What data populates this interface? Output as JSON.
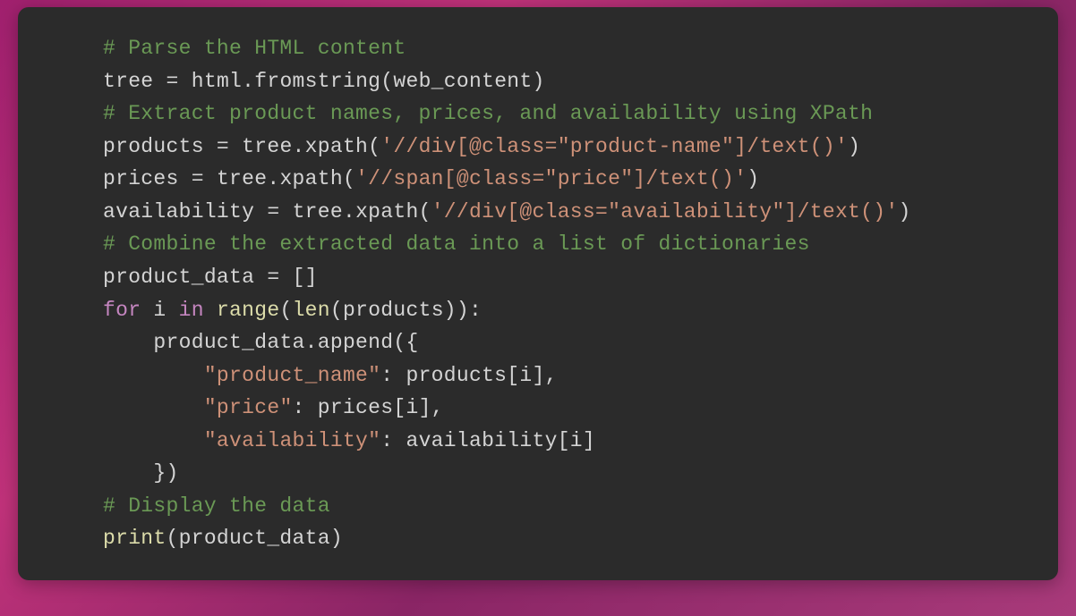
{
  "code": {
    "lines": [
      {
        "indent": 0,
        "tokens": [
          {
            "type": "comment",
            "text": "# Parse the HTML content"
          }
        ]
      },
      {
        "indent": 0,
        "tokens": [
          {
            "type": "identifier",
            "text": "tree "
          },
          {
            "type": "operator",
            "text": "= "
          },
          {
            "type": "identifier",
            "text": "html.fromstring(web_content)"
          }
        ]
      },
      {
        "indent": 0,
        "tokens": [
          {
            "type": "comment",
            "text": "# Extract product names, prices, and availability using XPath"
          }
        ]
      },
      {
        "indent": 0,
        "tokens": [
          {
            "type": "identifier",
            "text": "products "
          },
          {
            "type": "operator",
            "text": "= "
          },
          {
            "type": "identifier",
            "text": "tree.xpath("
          },
          {
            "type": "string",
            "text": "'//div[@class=\"product-name\"]/text()'"
          },
          {
            "type": "identifier",
            "text": ")"
          }
        ]
      },
      {
        "indent": 0,
        "tokens": [
          {
            "type": "identifier",
            "text": "prices "
          },
          {
            "type": "operator",
            "text": "= "
          },
          {
            "type": "identifier",
            "text": "tree.xpath("
          },
          {
            "type": "string",
            "text": "'//span[@class=\"price\"]/text()'"
          },
          {
            "type": "identifier",
            "text": ")"
          }
        ]
      },
      {
        "indent": 0,
        "tokens": [
          {
            "type": "identifier",
            "text": "availability "
          },
          {
            "type": "operator",
            "text": "= "
          },
          {
            "type": "identifier",
            "text": "tree.xpath("
          },
          {
            "type": "string",
            "text": "'//div[@class=\"availability\"]/text()'"
          },
          {
            "type": "identifier",
            "text": ")"
          }
        ]
      },
      {
        "indent": 0,
        "tokens": [
          {
            "type": "comment",
            "text": "# Combine the extracted data into a list of dictionaries"
          }
        ]
      },
      {
        "indent": 0,
        "tokens": [
          {
            "type": "identifier",
            "text": "product_data "
          },
          {
            "type": "operator",
            "text": "= "
          },
          {
            "type": "identifier",
            "text": "[]"
          }
        ]
      },
      {
        "indent": 0,
        "tokens": [
          {
            "type": "keyword-flow",
            "text": "for"
          },
          {
            "type": "identifier",
            "text": " i "
          },
          {
            "type": "keyword-flow",
            "text": "in"
          },
          {
            "type": "identifier",
            "text": " "
          },
          {
            "type": "function",
            "text": "range"
          },
          {
            "type": "identifier",
            "text": "("
          },
          {
            "type": "function",
            "text": "len"
          },
          {
            "type": "identifier",
            "text": "(products)):"
          }
        ]
      },
      {
        "indent": 1,
        "tokens": [
          {
            "type": "identifier",
            "text": "product_data.append({"
          }
        ]
      },
      {
        "indent": 2,
        "tokens": [
          {
            "type": "string",
            "text": "\"product_name\""
          },
          {
            "type": "identifier",
            "text": ": products[i],"
          }
        ]
      },
      {
        "indent": 2,
        "tokens": [
          {
            "type": "string",
            "text": "\"price\""
          },
          {
            "type": "identifier",
            "text": ": prices[i],"
          }
        ]
      },
      {
        "indent": 2,
        "tokens": [
          {
            "type": "string",
            "text": "\"availability\""
          },
          {
            "type": "identifier",
            "text": ": availability[i]"
          }
        ]
      },
      {
        "indent": 1,
        "tokens": [
          {
            "type": "identifier",
            "text": "})"
          }
        ]
      },
      {
        "indent": 0,
        "tokens": [
          {
            "type": "comment",
            "text": "# Display the data"
          }
        ]
      },
      {
        "indent": 0,
        "tokens": [
          {
            "type": "function",
            "text": "print"
          },
          {
            "type": "identifier",
            "text": "(product_data)"
          }
        ]
      }
    ],
    "indent_unit": "    "
  }
}
